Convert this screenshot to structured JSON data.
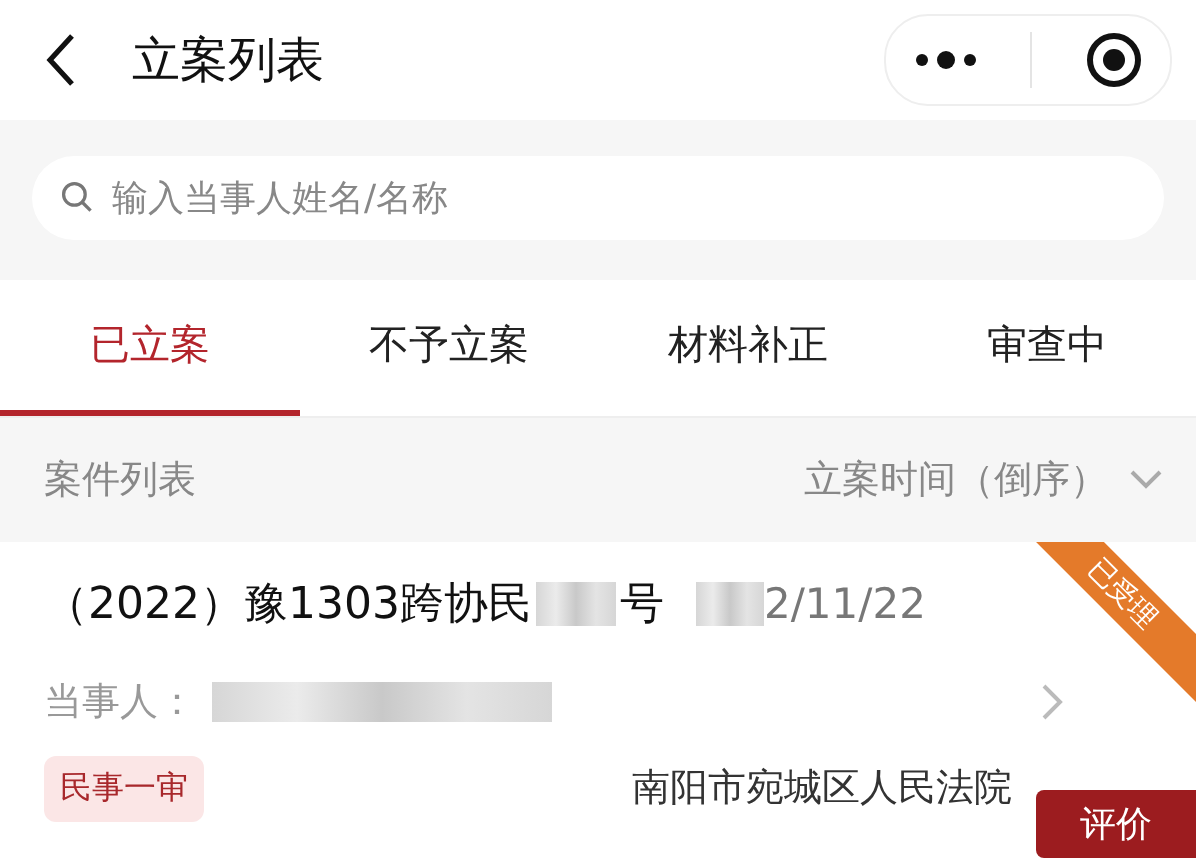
{
  "header": {
    "title": "立案列表"
  },
  "search": {
    "placeholder": "输入当事人姓名/名称"
  },
  "tabs": [
    {
      "label": "已立案",
      "selected": true
    },
    {
      "label": "不予立案",
      "selected": false
    },
    {
      "label": "材料补正",
      "selected": false
    },
    {
      "label": "审查中",
      "selected": false
    }
  ],
  "list_header": {
    "title": "案件列表",
    "sort": "立案时间（倒序）"
  },
  "cases": [
    {
      "case_number": "（2022）豫1303跨协民",
      "case_suffix": "号",
      "date": "2/11/22",
      "status": "已受理",
      "party_label": "当事人：",
      "case_type": "民事一审",
      "court": "南阳市宛城区人民法院",
      "action": "评价"
    }
  ]
}
